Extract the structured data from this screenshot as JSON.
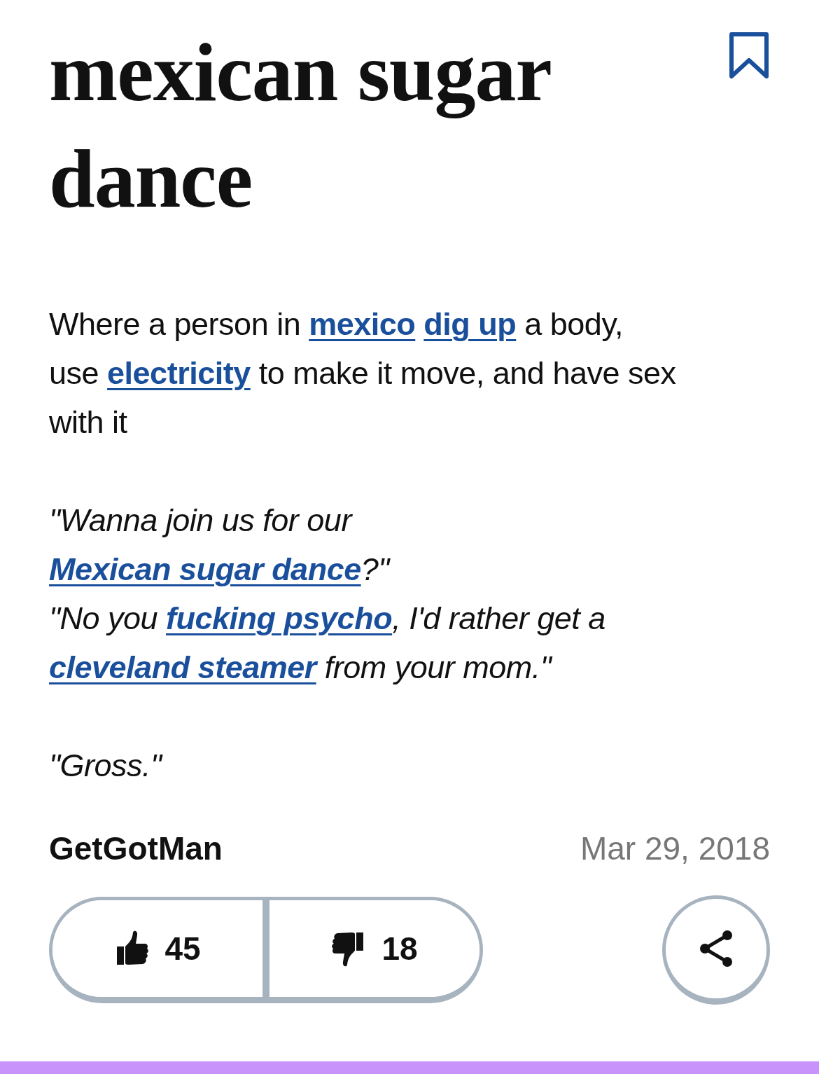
{
  "title": "mexican sugar dance",
  "bookmark": {
    "saved": false
  },
  "paragraphs": [
    {
      "italic": false,
      "lines": [
        [
          {
            "kind": "text",
            "text": "Where a person in "
          },
          {
            "kind": "link",
            "text": "mexico",
            "space_after": true
          },
          {
            "kind": "link",
            "text": "dig up"
          },
          {
            "kind": "text",
            "text": " a body, use "
          },
          {
            "kind": "link",
            "text": "electricity"
          },
          {
            "kind": "text",
            "text": " to make it move, and have sex with it"
          }
        ]
      ]
    },
    {
      "italic": true,
      "lines": [
        [
          {
            "kind": "text",
            "text": "\"Wanna join us for our "
          },
          {
            "kind": "link",
            "text": "Mexican sugar dance"
          },
          {
            "kind": "text",
            "text": "?\""
          }
        ],
        [
          {
            "kind": "text",
            "text": "\"No you "
          },
          {
            "kind": "link",
            "text": "fucking psycho"
          },
          {
            "kind": "text",
            "text": ", I'd rather get a "
          },
          {
            "kind": "link",
            "text": "cleveland steamer"
          },
          {
            "kind": "text",
            "text": " from your mom.\""
          }
        ]
      ]
    },
    {
      "italic": true,
      "lines": [
        [
          {
            "kind": "text",
            "text": "\"Gross.\""
          }
        ]
      ]
    }
  ],
  "author": "GetGotMan",
  "date": "Mar 29, 2018",
  "votes": {
    "up": "45",
    "down": "18"
  }
}
